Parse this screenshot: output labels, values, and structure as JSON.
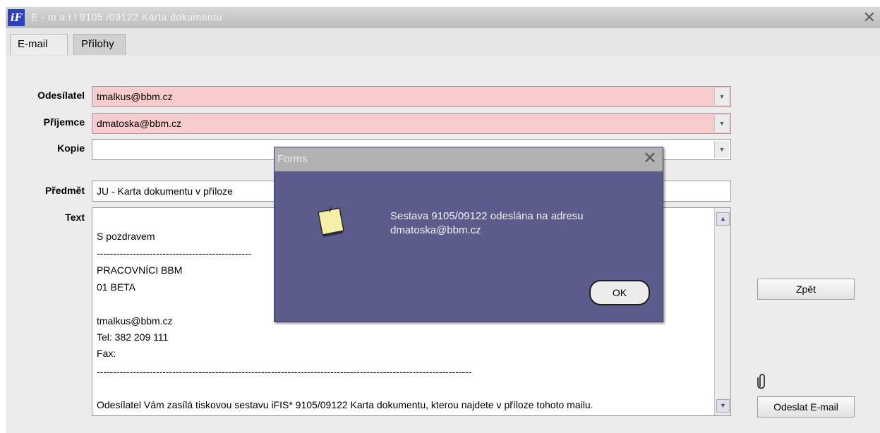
{
  "window": {
    "app_icon_text": "iF",
    "title": "E - m a i l   9105 /09122 Karta dokumentu",
    "close_glyph": "✕"
  },
  "tabs": [
    {
      "label": "E-mail",
      "active": true
    },
    {
      "label": "Přílohy",
      "active": false
    }
  ],
  "form": {
    "sender": {
      "label": "Odesílatel",
      "value": "tmalkus@bbm.cz"
    },
    "recipient": {
      "label": "Příjemce",
      "value": "dmatoska@bbm.cz"
    },
    "copy": {
      "label": "Kopie",
      "value": ""
    },
    "subject": {
      "label": "Předmět",
      "value": "JU - Karta dokumentu v příloze"
    },
    "text": {
      "label": "Text",
      "lines": [
        "S pozdravem",
        "-----------------------------------------------",
        "PRACOVNÍCI BBM",
        "01 BETA",
        "",
        "tmalkus@bbm.cz",
        "Tel: 382 209 111",
        "Fax:",
        "------------------------------------------------------------------------------------------------------------------",
        "",
        "Odesílatel Vám zasílá tiskovou sestavu iFIS* 9105/09122 Karta dokumentu, kterou najdete v příloze tohoto mailu."
      ]
    }
  },
  "buttons": {
    "back": "Zpět",
    "send": "Odeslat E-mail",
    "attachment_icon": "paperclip-icon"
  },
  "dialog": {
    "title": "Forms",
    "message_line1": "Sestava 9105/09122 odeslána na adresu",
    "message_line2": "dmatoska@bbm.cz",
    "ok_label": "OK",
    "icon": "note-icon"
  },
  "colors": {
    "required_field": "#f8cccc",
    "dialog_bg": "#5b5b8c",
    "panel_bg": "#ececec"
  }
}
